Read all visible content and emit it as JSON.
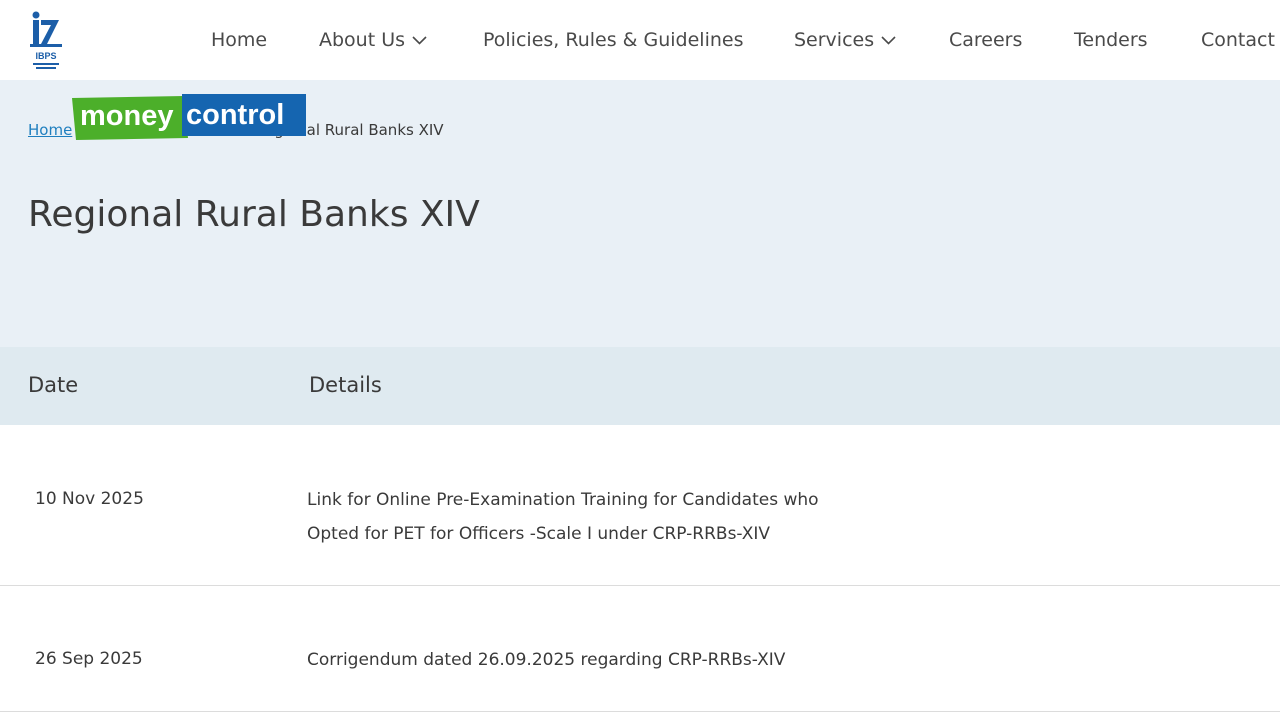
{
  "header": {
    "logo_text": "IBPS",
    "nav": [
      {
        "label": "Home",
        "has_dropdown": false
      },
      {
        "label": "About Us",
        "has_dropdown": true
      },
      {
        "label": "Policies, Rules & Guidelines",
        "has_dropdown": false
      },
      {
        "label": "Services",
        "has_dropdown": true
      },
      {
        "label": "Careers",
        "has_dropdown": false
      },
      {
        "label": "Tenders",
        "has_dropdown": false
      },
      {
        "label": "Contact",
        "has_dropdown": false
      }
    ]
  },
  "breadcrumb": {
    "home": "Home",
    "current": "Regional Rural Banks XIV"
  },
  "watermark": {
    "text_a": "money",
    "text_b": "control"
  },
  "page": {
    "title": "Regional Rural Banks XIV"
  },
  "table": {
    "headers": {
      "date": "Date",
      "details": "Details"
    },
    "rows": [
      {
        "date": "10 Nov 2025",
        "details": "Link for Online Pre-Examination Training for Candidates who Opted for PET for Officers -Scale I under CRP-RRBs-XIV"
      },
      {
        "date": "26 Sep 2025",
        "details": "Corrigendum dated 26.09.2025 regarding CRP-RRBs-XIV"
      }
    ]
  },
  "colors": {
    "hero_bg": "#e9f0f6",
    "table_header_bg": "#dfeaf0",
    "link": "#1f7fbf",
    "logo_blue": "#1c5ea8",
    "watermark_green": "#4caf2a",
    "watermark_blue": "#1565b0"
  }
}
